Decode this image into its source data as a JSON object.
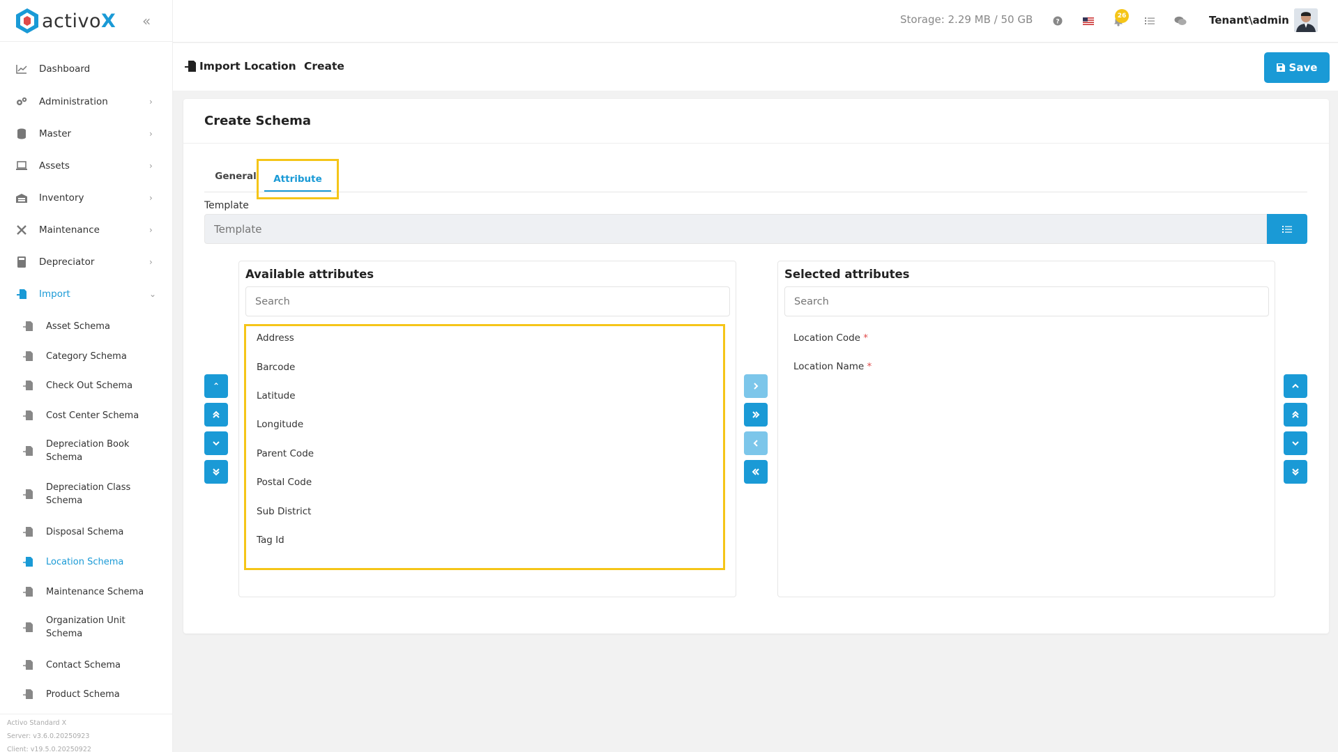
{
  "app": {
    "logo_text": "activo",
    "logo_x": "X",
    "brand_color": "#1a9ad6",
    "highlight_color": "#f5c518"
  },
  "sidebar": {
    "items": [
      {
        "label": "Dashboard",
        "icon": "chart-line-icon"
      },
      {
        "label": "Administration",
        "icon": "gears-icon"
      },
      {
        "label": "Master",
        "icon": "database-icon"
      },
      {
        "label": "Assets",
        "icon": "laptop-icon"
      },
      {
        "label": "Inventory",
        "icon": "warehouse-icon"
      },
      {
        "label": "Maintenance",
        "icon": "tools-icon"
      },
      {
        "label": "Depreciator",
        "icon": "calculator-icon"
      },
      {
        "label": "Import",
        "icon": "file-import-icon"
      }
    ],
    "sub_items": [
      {
        "label": "Asset Schema"
      },
      {
        "label": "Category Schema"
      },
      {
        "label": "Check Out Schema"
      },
      {
        "label": "Cost Center Schema"
      },
      {
        "label": "Depreciation Book Schema"
      },
      {
        "label": "Depreciation Class Schema"
      },
      {
        "label": "Disposal Schema"
      },
      {
        "label": "Location Schema"
      },
      {
        "label": "Maintenance Schema"
      },
      {
        "label": "Organization Unit Schema"
      },
      {
        "label": "Contact Schema"
      },
      {
        "label": "Product Schema"
      }
    ],
    "footer": {
      "product": "Activo Standard X",
      "server": "Server: v3.6.0.20250923",
      "client": "Client: v19.5.0.20250922"
    }
  },
  "header": {
    "storage": "Storage: 2.29 MB / 50 GB",
    "notification_count": "26",
    "user": "Tenant\\admin"
  },
  "toolbar": {
    "breadcrumb_parent": "Import Location",
    "breadcrumb_current": "Create",
    "save_label": "Save"
  },
  "card": {
    "title": "Create Schema",
    "tabs": [
      {
        "label": "General"
      },
      {
        "label": "Attribute"
      }
    ],
    "template_label": "Template",
    "template_placeholder": "Template"
  },
  "available": {
    "title": "Available attributes",
    "search_placeholder": "Search",
    "items": [
      "Address",
      "Barcode",
      "Latitude",
      "Longitude",
      "Parent Code",
      "Postal Code",
      "Sub District",
      "Tag Id"
    ]
  },
  "selected": {
    "title": "Selected attributes",
    "search_placeholder": "Search",
    "items": [
      {
        "label": "Location Code",
        "required": "*"
      },
      {
        "label": "Location Name",
        "required": "*"
      }
    ]
  }
}
